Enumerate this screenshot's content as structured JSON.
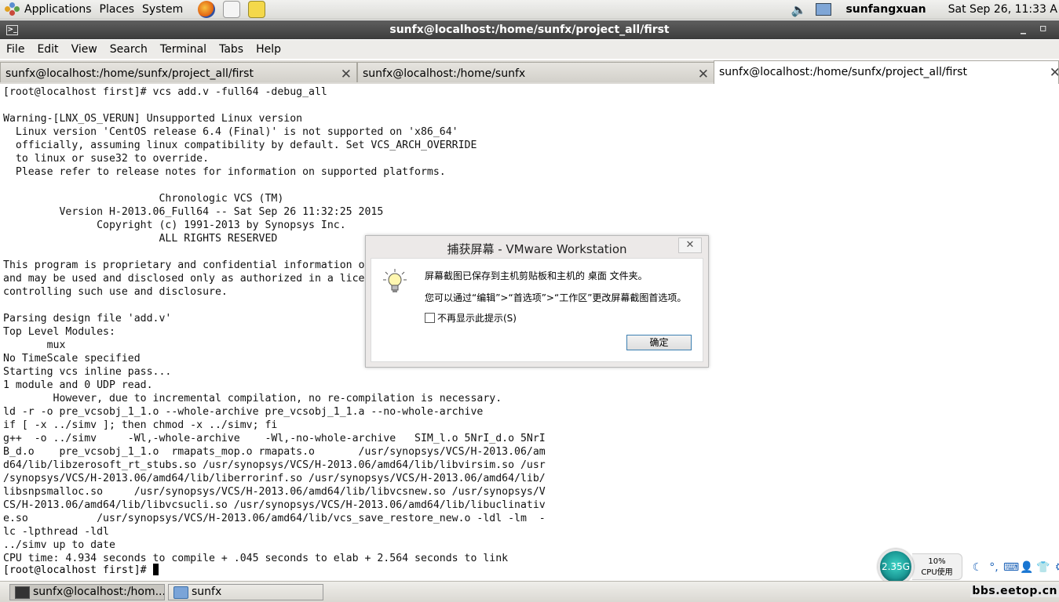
{
  "top_panel": {
    "applications": "Applications",
    "places": "Places",
    "system": "System",
    "user": "sunfangxuan",
    "clock": "Sat Sep 26, 11:33 A"
  },
  "window": {
    "title": "sunfx@localhost:/home/sunfx/project_all/first",
    "minimize": "_",
    "maximize": "▫"
  },
  "menubar": [
    "File",
    "Edit",
    "View",
    "Search",
    "Terminal",
    "Tabs",
    "Help"
  ],
  "tabs": [
    {
      "label": "sunfx@localhost:/home/sunfx/project_all/first",
      "close": "✕"
    },
    {
      "label": "sunfx@localhost:/home/sunfx",
      "close": "✕"
    },
    {
      "label": "sunfx@localhost:/home/sunfx/project_all/first",
      "close": "✕"
    }
  ],
  "terminal": {
    "output": "[root@localhost first]# vcs add.v -full64 -debug_all\n\nWarning-[LNX_OS_VERUN] Unsupported Linux version\n  Linux version 'CentOS release 6.4 (Final)' is not supported on 'x86_64'\n  officially, assuming linux compatibility by default. Set VCS_ARCH_OVERRIDE\n  to linux or suse32 to override.\n  Please refer to release notes for information on supported platforms.\n\n                         Chronologic VCS (TM)\n         Version H-2013.06_Full64 -- Sat Sep 26 11:32:25 2015\n               Copyright (c) 1991-2013 by Synopsys Inc.\n                         ALL RIGHTS RESERVED\n\nThis program is proprietary and confidential information of Synopsys Inc.\nand may be used and disclosed only as authorized in a license agreement\ncontrolling such use and disclosure.\n\nParsing design file 'add.v'\nTop Level Modules:\n       mux\nNo TimeScale specified\nStarting vcs inline pass...\n1 module and 0 UDP read.\n        However, due to incremental compilation, no re-compilation is necessary.\nld -r -o pre_vcsobj_1_1.o --whole-archive pre_vcsobj_1_1.a --no-whole-archive\nif [ -x ../simv ]; then chmod -x ../simv; fi\ng++  -o ../simv     -Wl,-whole-archive    -Wl,-no-whole-archive   SIM_l.o 5NrI_d.o 5NrI\nB_d.o    pre_vcsobj_1_1.o  rmapats_mop.o rmapats.o       /usr/synopsys/VCS/H-2013.06/am\nd64/lib/libzerosoft_rt_stubs.so /usr/synopsys/VCS/H-2013.06/amd64/lib/libvirsim.so /usr\n/synopsys/VCS/H-2013.06/amd64/lib/liberrorinf.so /usr/synopsys/VCS/H-2013.06/amd64/lib/\nlibsnpsmalloc.so     /usr/synopsys/VCS/H-2013.06/amd64/lib/libvcsnew.so /usr/synopsys/V\nCS/H-2013.06/amd64/lib/libvcsucli.so /usr/synopsys/VCS/H-2013.06/amd64/lib/libuclinativ\ne.so           /usr/synopsys/VCS/H-2013.06/amd64/lib/vcs_save_restore_new.o -ldl -lm  -\nlc -lpthread -ldl\n../simv up to date\nCPU time: 4.934 seconds to compile + .045 seconds to elab + 2.564 seconds to link",
    "prompt": "[root@localhost first]# "
  },
  "dialog": {
    "title": "捕获屏幕 - VMware Workstation",
    "close": "✕",
    "message1": "屏幕截图已保存到主机剪贴板和主机的 桌面 文件夹。",
    "message2": "您可以通过“编辑”>“首选项”>“工作区”更改屏幕截图首选项。",
    "checkbox_label": "不再显示此提示(S)",
    "ok_button": "确定",
    "icon": "lightbulb-icon"
  },
  "cpu_widget": {
    "memory": "2.35G",
    "cpu_percent": "10%",
    "cpu_label": "CPU使用"
  },
  "taskbar": {
    "items": [
      {
        "label": "sunfx@localhost:/hom...",
        "icon": "terminal-icon"
      },
      {
        "label": "sunfx",
        "icon": "folder-icon"
      }
    ],
    "watermark": "bbs.eetop.cn"
  }
}
